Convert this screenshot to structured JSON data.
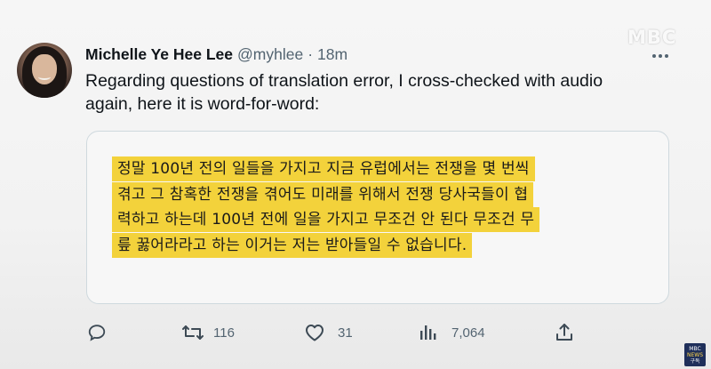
{
  "author": {
    "name": "Michelle Ye Hee Lee",
    "handle": "@myhlee",
    "separator": "·",
    "time": "18m"
  },
  "tweet": {
    "text": "Regarding questions of translation error, I cross-checked with audio again, here it is word-for-word:"
  },
  "quote_card": {
    "lines": [
      "정말 100년 전의 일들을 가지고 지금 유럽에서는 전쟁을 몇 번씩",
      "겪고 그 참혹한 전쟁을 겪어도 미래를 위해서 전쟁 당사국들이 협",
      "력하고 하는데 100년 전에 일을 가지고 무조건 안 된다 무조건 무",
      "릎 꿇어라라고 하는 이거는 저는 받아들일 수 없습니다."
    ],
    "highlight_color": "#f3d23b"
  },
  "actions": {
    "reply": {
      "icon": "reply-icon",
      "count": ""
    },
    "retweet": {
      "icon": "retweet-icon",
      "count": "116"
    },
    "like": {
      "icon": "heart-icon",
      "count": "31"
    },
    "views": {
      "icon": "views-icon",
      "count": "7,064"
    },
    "share": {
      "icon": "share-icon",
      "count": ""
    }
  },
  "watermark": {
    "text": "MBC"
  },
  "badge": {
    "line1": "MBC",
    "line2": "NEWS",
    "line3": "구독"
  }
}
